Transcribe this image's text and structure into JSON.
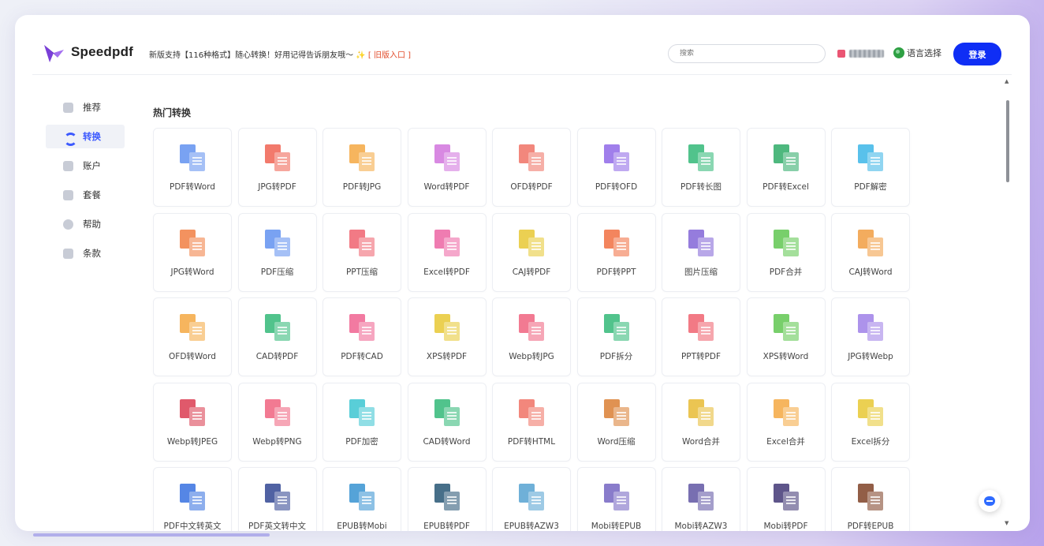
{
  "header": {
    "brand": "Speedpdf",
    "notice_text": "新版支持【116种格式】随心转换！好用记得告诉朋友哦～ ",
    "notice_sparkle": "✨",
    "notice_old_link": "[ 旧版入口 ]",
    "search_placeholder": "搜索",
    "language_label": "语言选择",
    "login_label": "登录"
  },
  "sidebar": {
    "items": [
      {
        "label": "推荐",
        "icon": "gift-icon"
      },
      {
        "label": "转换",
        "icon": "convert-icon"
      },
      {
        "label": "账户",
        "icon": "user-icon"
      },
      {
        "label": "套餐",
        "icon": "card-icon"
      },
      {
        "label": "帮助",
        "icon": "help-icon"
      },
      {
        "label": "条款",
        "icon": "document-icon"
      }
    ],
    "active_item": "转换"
  },
  "main": {
    "section_title": "热门转换",
    "tools": [
      {
        "label": "PDF转Word",
        "icon": "pdf-to-word-icon",
        "color": "#5b8def"
      },
      {
        "label": "JPG转PDF",
        "icon": "jpg-to-pdf-icon",
        "color": "#ef5d4c"
      },
      {
        "label": "PDF转JPG",
        "icon": "pdf-to-jpg-icon",
        "color": "#f4a53a"
      },
      {
        "label": "Word转PDF",
        "icon": "word-to-pdf-icon",
        "color": "#cf6fdc"
      },
      {
        "label": "OFD转PDF",
        "icon": "ofd-to-pdf-icon",
        "color": "#ef6d5f"
      },
      {
        "label": "PDF转OFD",
        "icon": "pdf-to-ofd-icon",
        "color": "#8b63e6"
      },
      {
        "label": "PDF转长图",
        "icon": "pdf-to-long-image-icon",
        "color": "#2bb673"
      },
      {
        "label": "PDF转Excel",
        "icon": "pdf-to-excel-icon",
        "color": "#27a862"
      },
      {
        "label": "PDF解密",
        "icon": "pdf-decrypt-icon",
        "color": "#35b3e6"
      },
      {
        "label": "JPG转Word",
        "icon": "jpg-to-word-icon",
        "color": "#f07a3c"
      },
      {
        "label": "PDF压缩",
        "icon": "pdf-compress-icon",
        "color": "#5b8def"
      },
      {
        "label": "PPT压缩",
        "icon": "ppt-compress-icon",
        "color": "#ef5d6a"
      },
      {
        "label": "Excel转PDF",
        "icon": "excel-to-pdf-icon",
        "color": "#ec5fa0"
      },
      {
        "label": "CAJ转PDF",
        "icon": "caj-to-pdf-icon",
        "color": "#e6c62c"
      },
      {
        "label": "PDF转PPT",
        "icon": "pdf-to-ppt-icon",
        "color": "#f06a3a"
      },
      {
        "label": "图片压缩",
        "icon": "image-compress-icon",
        "color": "#7e5fd6"
      },
      {
        "label": "PDF合并",
        "icon": "pdf-merge-icon",
        "color": "#5ac54a"
      },
      {
        "label": "CAJ转Word",
        "icon": "caj-to-word-icon",
        "color": "#f09a3a"
      },
      {
        "label": "OFD转Word",
        "icon": "ofd-to-word-icon",
        "color": "#f4a53a"
      },
      {
        "label": "CAD转PDF",
        "icon": "cad-to-pdf-icon",
        "color": "#2bb673"
      },
      {
        "label": "PDF转CAD",
        "icon": "pdf-to-cad-icon",
        "color": "#ef5d8c"
      },
      {
        "label": "XPS转PDF",
        "icon": "xps-to-pdf-icon",
        "color": "#e6c62c"
      },
      {
        "label": "Webp转JPG",
        "icon": "webp-to-jpg-icon",
        "color": "#ef5d7a"
      },
      {
        "label": "PDF拆分",
        "icon": "pdf-split-icon",
        "color": "#2bb673"
      },
      {
        "label": "PPT转PDF",
        "icon": "ppt-to-pdf-icon",
        "color": "#ef5d6a"
      },
      {
        "label": "XPS转Word",
        "icon": "xps-to-word-icon",
        "color": "#5ac54a"
      },
      {
        "label": "JPG转Webp",
        "icon": "jpg-to-webp-icon",
        "color": "#9b7be6"
      },
      {
        "label": "Webp转JPEG",
        "icon": "webp-to-jpeg-icon",
        "color": "#d9354a"
      },
      {
        "label": "Webp转PNG",
        "icon": "webp-to-png-icon",
        "color": "#ef5d7a"
      },
      {
        "label": "PDF加密",
        "icon": "pdf-encrypt-icon",
        "color": "#35c3d0"
      },
      {
        "label": "CAD转Word",
        "icon": "cad-to-word-icon",
        "color": "#2bb673"
      },
      {
        "label": "PDF转HTML",
        "icon": "pdf-to-html-icon",
        "color": "#ef6d5f"
      },
      {
        "label": "Word压缩",
        "icon": "word-compress-icon",
        "color": "#d97a2c"
      },
      {
        "label": "Word合并",
        "icon": "word-merge-icon",
        "color": "#e6b82c"
      },
      {
        "label": "Excel合并",
        "icon": "excel-merge-icon",
        "color": "#f4a53a"
      },
      {
        "label": "Excel拆分",
        "icon": "excel-split-icon",
        "color": "#e6c62c"
      },
      {
        "label": "PDF中文转英文",
        "icon": "pdf-chinese-to-english-icon",
        "color": "#2f6bdf"
      },
      {
        "label": "PDF英文转中文",
        "icon": "pdf-english-to-chinese-icon",
        "color": "#2a3f8f"
      },
      {
        "label": "EPUB转Mobi",
        "icon": "epub-to-mobi-icon",
        "color": "#2f8fcf"
      },
      {
        "label": "EPUB转PDF",
        "icon": "epub-to-pdf-icon",
        "color": "#1f4f6f"
      },
      {
        "label": "EPUB转AZW3",
        "icon": "epub-to-azw3-icon",
        "color": "#4f9fcf"
      },
      {
        "label": "Mobi转EPUB",
        "icon": "mobi-to-epub-icon",
        "color": "#6f5fc0"
      },
      {
        "label": "Mobi转AZW3",
        "icon": "mobi-to-azw3-icon",
        "color": "#5a4fa0"
      },
      {
        "label": "Mobi转PDF",
        "icon": "mobi-to-pdf-icon",
        "color": "#3a2f70"
      },
      {
        "label": "PDF转EPUB",
        "icon": "pdf-to-epub-icon",
        "color": "#7a3a1f"
      }
    ]
  }
}
